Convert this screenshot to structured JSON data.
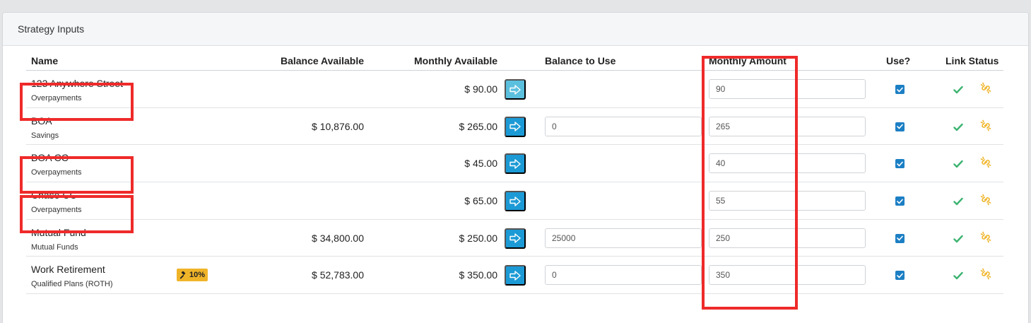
{
  "panel": {
    "title": "Strategy Inputs"
  },
  "columns": {
    "name": "Name",
    "balance_available": "Balance Available",
    "monthly_available": "Monthly Available",
    "balance_to_use": "Balance to Use",
    "monthly_amount": "Monthly Amount",
    "use": "Use?",
    "link_status": "Link Status"
  },
  "rows": [
    {
      "name": "123 Anywhere Street",
      "sub": "Overpayments",
      "balance_available": "",
      "monthly_available": "$ 90.00",
      "balance_to_use": null,
      "monthly_amount": "90",
      "use": true
    },
    {
      "name": "BOA",
      "sub": "Savings",
      "balance_available": "$ 10,876.00",
      "monthly_available": "$ 265.00",
      "balance_to_use": "0",
      "monthly_amount": "265",
      "use": true
    },
    {
      "name": "BOA CC",
      "sub": "Overpayments",
      "balance_available": "",
      "monthly_available": "$ 45.00",
      "balance_to_use": null,
      "monthly_amount": "40",
      "use": true
    },
    {
      "name": "Chase CC",
      "sub": "Overpayments",
      "balance_available": "",
      "monthly_available": "$ 65.00",
      "balance_to_use": null,
      "monthly_amount": "55",
      "use": true
    },
    {
      "name": "Mutual Fund",
      "sub": "Mutual Funds",
      "balance_available": "$ 34,800.00",
      "monthly_available": "$ 250.00",
      "balance_to_use": "25000",
      "monthly_amount": "250",
      "use": true
    },
    {
      "name": "Work Retirement",
      "sub": "Qualified Plans (ROTH)",
      "badge": "10%",
      "balance_available": "$ 52,783.00",
      "monthly_available": "$ 350.00",
      "balance_to_use": "0",
      "monthly_amount": "350",
      "use": true
    }
  ],
  "icons": {
    "transfer": "arrow-right-icon",
    "use": "checkbox-checked-icon",
    "status_ok": "checkmark-icon",
    "status_link": "unlink-icon",
    "badge": "gavel-icon"
  },
  "colors": {
    "primary_button": "#1c9ad6",
    "light_button": "#5bc0de",
    "checkbox": "#1c7fc4",
    "status_ok": "#3cb371",
    "status_link": "#f0b429",
    "badge": "#f0b429",
    "highlight": "#ef2a2a"
  }
}
